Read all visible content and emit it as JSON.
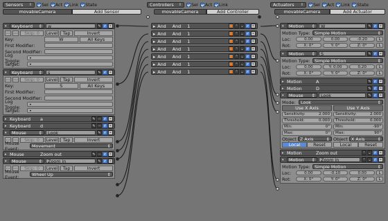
{
  "sensors_bar": {
    "dropdown": "Sensors",
    "sel": "Sel",
    "act": "Act",
    "link": "Link",
    "state": "State",
    "object": "movableCamera",
    "add": "Add Sensor"
  },
  "controllers_bar": {
    "dropdown": "Controllers",
    "sel": "Sel",
    "act": "Act",
    "link": "Link",
    "object": "movableCamera",
    "add": "Add Controller"
  },
  "actuators_bar": {
    "dropdown": "Actuators",
    "sel": "Sel",
    "act": "Act",
    "link": "Link",
    "state": "State",
    "object": "movableCamera",
    "add": "Add Actuator"
  },
  "sensors": {
    "kb_w": {
      "type": "Keyboard",
      "name": "w",
      "skip": "Skip:",
      "skip_val": "0",
      "level": "Level",
      "tap": "Tap",
      "invert": "Invert",
      "key_label": "Key:",
      "key": "W",
      "all_keys": "All Keys",
      "first_mod": "First Modifier:",
      "second_mod": "Second Modifier:",
      "log_toggle": "Log Toggle:",
      "target": "Target:"
    },
    "kb_s": {
      "type": "Keyboard",
      "name": "s",
      "skip": "Skip:",
      "skip_val": "0",
      "level": "Level",
      "tap": "Tap",
      "invert": "Invert",
      "key_label": "Key:",
      "key": "S",
      "all_keys": "All Keys",
      "first_mod": "First Modifier:",
      "second_mod": "Second Modifier:",
      "log_toggle": "Log Toggle:",
      "target": "Target:"
    },
    "kb_a": {
      "type": "Keyboard",
      "name": "a"
    },
    "kb_d": {
      "type": "Keyboard",
      "name": "d"
    },
    "mouse_look": {
      "type": "Mouse",
      "name": "Look",
      "skip": "Skip:",
      "skip_val": "0",
      "level": "Level",
      "tap": "Tap",
      "invert": "Invert",
      "event_label": "Mouse Event:",
      "event": "Movement"
    },
    "mouse_zoomout": {
      "type": "Mouse",
      "name": "Zoom out"
    },
    "mouse_zoomin": {
      "type": "Mouse",
      "name": "Zoom in",
      "skip": "Skip:",
      "skip_val": "0",
      "level": "Level",
      "tap": "Tap",
      "invert": "Invert",
      "event_label": "Mouse Event:",
      "event": "Wheel Up"
    }
  },
  "controllers": [
    {
      "type": "And",
      "name": "And",
      "num": "1"
    },
    {
      "type": "And",
      "name": "And",
      "num": "1"
    },
    {
      "type": "And",
      "name": "And",
      "num": "1"
    },
    {
      "type": "And",
      "name": "And",
      "num": "1"
    },
    {
      "type": "And",
      "name": "And",
      "num": "1"
    },
    {
      "type": "And",
      "name": "And",
      "num": "1"
    },
    {
      "type": "And",
      "name": "And",
      "num": "1"
    }
  ],
  "actuators": {
    "motion_w": {
      "type": "Motion",
      "name": "W",
      "mtype_label": "Motion Type:",
      "mtype": "Simple Motion",
      "loc_label": "Loc:",
      "loc": [
        "0.00",
        "0.00",
        "-0.20"
      ],
      "rot_label": "Rot:",
      "rot": [
        "X:  0°",
        "Y:  0°",
        "Z:  0°"
      ],
      "L": "L"
    },
    "motion_s": {
      "type": "Motion",
      "name": "S",
      "mtype_label": "Motion Type:",
      "mtype": "Simple Motion",
      "loc_label": "Loc:",
      "loc": [
        "0.00",
        "Y: 0.00",
        "0.20"
      ],
      "rot_label": "Rot:",
      "rot": [
        "X:  0°",
        "Y:  0°",
        "Z:  0°"
      ],
      "L": "L"
    },
    "motion_a": {
      "type": "Motion",
      "name": "A"
    },
    "motion_d": {
      "type": "Motion",
      "name": "D"
    },
    "mouse_look": {
      "type": "Mouse",
      "name": "Look",
      "mode_label": "Mode:",
      "mode": "Look",
      "usex": "Use X Axis",
      "usey": "Use Y Axis",
      "sens_label": "Sensitivity:",
      "sens_x": "2.000",
      "sens_y": "2.000",
      "thr_label": "Threshold:",
      "thr_x": "0.000",
      "thr_y": "0.000",
      "min_label": "Min:",
      "min_x": "0°",
      "min_y": "-90°",
      "max_label": "Max:",
      "max_x": "0°",
      "max_y": "90°",
      "obj_label": "Object",
      "axis_x": "Z Axis",
      "axis_y": "X Axis",
      "local": "Local",
      "reset": "Reset"
    },
    "motion_zoomout": {
      "type": "Motion",
      "name": "Zoom out"
    },
    "motion_zoomin": {
      "type": "Motion",
      "name": "Zoom in",
      "mtype_label": "Motion Type:",
      "mtype": "Simple Motion",
      "loc_label": "Loc:",
      "loc": [
        "0.00",
        "-0.10",
        "0.00"
      ],
      "rot_label": "Rot:",
      "rot": [
        "X:  0°",
        "Y:  0°",
        "Z:  0°"
      ],
      "L": "L"
    }
  }
}
